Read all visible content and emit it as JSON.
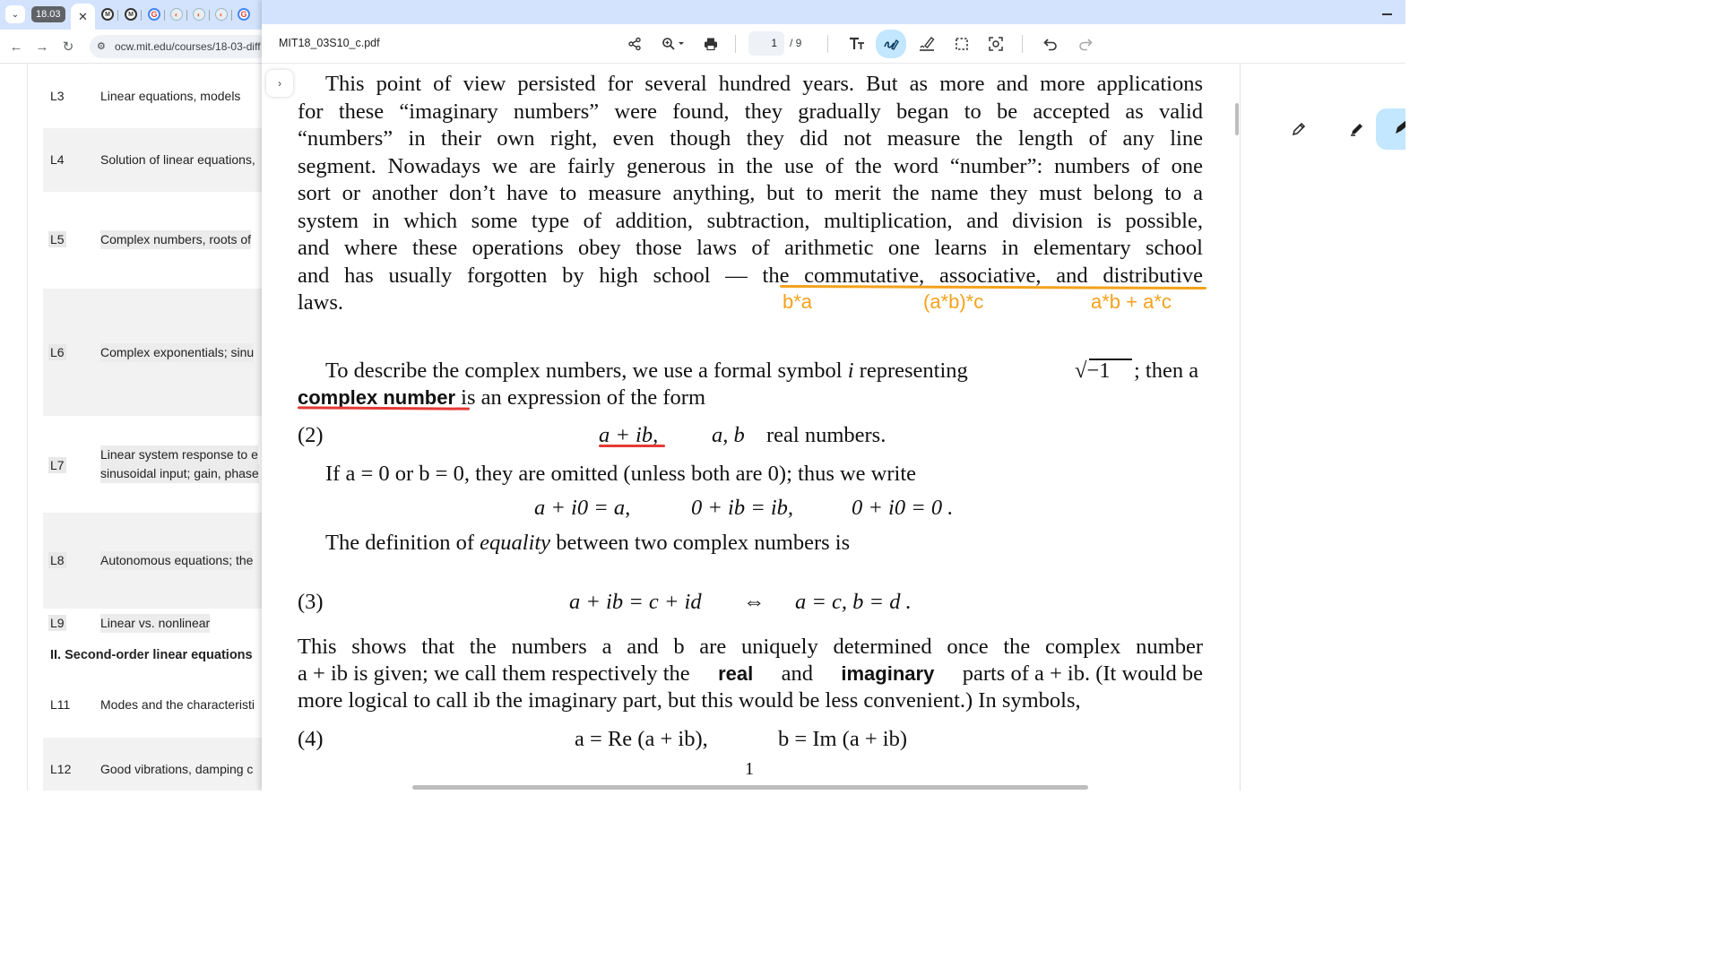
{
  "browser": {
    "tab_group_label": "18.03",
    "active_tab_close": "✕",
    "url": "ocw.mit.edu/courses/18-03-diff",
    "course_rows": [
      {
        "id": "L3",
        "title": "Linear equations, models"
      },
      {
        "id": "L4",
        "title": "Solution of linear equations,"
      },
      {
        "id": "L5",
        "title": "Complex numbers, roots of"
      },
      {
        "id": "L6",
        "title": "Complex exponentials; sinu"
      },
      {
        "id": "L7",
        "title_line1": "Linear system response to e",
        "title_line2": "sinusoidal input; gain, phase"
      },
      {
        "id": "L8",
        "title": "Autonomous equations; the"
      },
      {
        "id": "L9",
        "title": "Linear vs. nonlinear"
      },
      {
        "id": "L11",
        "title": "Modes and the characteristi"
      },
      {
        "id": "L12",
        "title": "Good vibrations, damping c"
      }
    ],
    "section_heading": "II. Second-order linear equations"
  },
  "viewer": {
    "file_name": "MIT18_03S10_c.pdf",
    "current_page": "1",
    "page_total": "/   9",
    "side_toggle": "›"
  },
  "pdf": {
    "para1": [
      "This point of view persisted for several hundred years. But as more and more applications",
      "for these “imaginary numbers” were found, they gradually began to be accepted as valid",
      "“numbers” in their own right, even though they did not measure the length of any line",
      "segment. Nowadays we are fairly generous in the use of the word “number”: numbers of one",
      "sort or another don’t have to measure anything, but to merit the name they must belong to a",
      "system in which some type of addition, subtraction, multiplication, and division is possible,",
      "and where these operations obey those laws of arithmetic one learns in elementary school",
      "and has usually forgotten by high school — the commutative, associative, and distributive",
      "laws."
    ],
    "annotations": [
      "b*a",
      "(a*b)*c",
      "a*b + a*c"
    ],
    "para2_line1_a": "To describe the complex numbers, we use a formal symbol",
    "para2_line1_i": "i",
    "para2_line1_b": "representing",
    "para2_sqrt": "−1",
    "para2_line1_c": "; then a",
    "para2_term": "complex number",
    "para2_line2_rest": "is an expression of the form",
    "eq2_label": "(2)",
    "eq2_expr": "a + ib,",
    "eq2_vars": "a, b",
    "eq2_text": "real numbers.",
    "line_if": "If a = 0 or b = 0, they are omitted (unless both are 0); thus we write",
    "eq_omit_1": "a + i0 = a,",
    "eq_omit_2": "0 + ib = ib,",
    "eq_omit_3": "0 + i0 = 0 .",
    "line_def_a": "The definition of",
    "line_def_it": "equality",
    "line_def_b": "between two complex numbers is",
    "eq3_label": "(3)",
    "eq3_lhs": "a + ib = c + id",
    "eq3_iff": "⇔",
    "eq3_rhs": "a = c,  b = d .",
    "para3_line1": "This shows that the numbers a and b are uniquely determined once the complex number",
    "para3_line2_a": "a + ib is given; we call them respectively the",
    "para3_real": "real",
    "para3_and": "and",
    "para3_imag": "imaginary",
    "para3_line2_b": "parts of a + ib. (It would be",
    "para3_line3": "more logical to call ib the imaginary part, but this would be less convenient.) In symbols,",
    "eq4_label": "(4)",
    "eq4_a": "a = Re (a + ib),",
    "eq4_b": "b = Im (a + ib)",
    "page_number": "1"
  },
  "colors": {
    "title_bar": "#d3e3fd",
    "active_tool": "#c2e7ff",
    "annotation_orange": "#f3a21b",
    "annotation_red": "#e53935"
  },
  "icons": [
    "chevron-down-icon",
    "close-icon",
    "back-arrow-icon",
    "forward-arrow-icon",
    "reload-icon",
    "site-info-icon",
    "share-icon",
    "zoom-icon",
    "print-icon",
    "text-size-icon",
    "draw-icon",
    "highlight-icon",
    "select-area-icon",
    "screenshot-icon",
    "undo-icon",
    "redo-icon",
    "pen-icon",
    "highlighter-icon",
    "minimize-icon"
  ]
}
